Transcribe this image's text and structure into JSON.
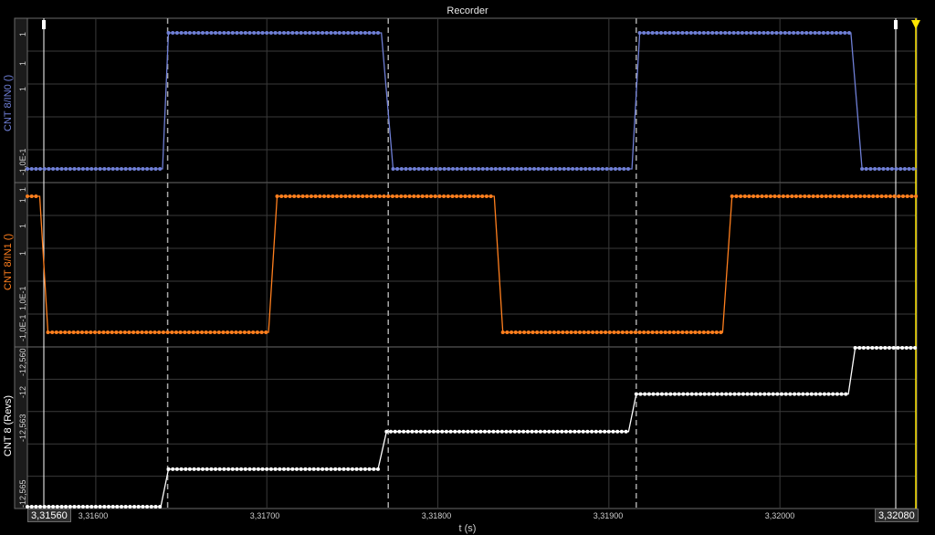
{
  "window": {
    "title": "Recorder"
  },
  "colors": {
    "in0": "#6f7fd6",
    "in1": "#ff7f1e",
    "revs": "#ffffff",
    "cursor": "#ffe600",
    "grid": "#3a3a3a",
    "frame": "#6a6a6a"
  },
  "chart_data": [
    {
      "type": "line",
      "name": "panel-in0",
      "ylabel": "CNT 8/IN0 ()",
      "y_ticks": [
        "1",
        "1",
        "1",
        "-1,0E-1",
        "1"
      ],
      "ylim": [
        -0.1,
        1
      ],
      "x_unit": "s",
      "transitions": [
        {
          "t": 3.3156,
          "y": -0.1
        },
        {
          "t": 3.31639,
          "y": -0.1
        },
        {
          "t": 3.316425,
          "y": 1
        },
        {
          "t": 3.31767,
          "y": 1
        },
        {
          "t": 3.317738,
          "y": -0.1
        },
        {
          "t": 3.319135,
          "y": -0.1
        },
        {
          "t": 3.31918,
          "y": 1
        },
        {
          "t": 3.320415,
          "y": 1
        },
        {
          "t": 3.32048,
          "y": -0.1
        },
        {
          "t": 3.3208,
          "y": -0.1
        }
      ]
    },
    {
      "type": "line",
      "name": "panel-in1",
      "ylabel": "CNT 8/IN1 ()",
      "y_ticks": [
        "1",
        "1",
        "1",
        "1,0E-1",
        "-1,0E-1"
      ],
      "ylim": [
        -0.1,
        1
      ],
      "x_unit": "s",
      "transitions": [
        {
          "t": 3.3156,
          "y": 1
        },
        {
          "t": 3.315672,
          "y": 1
        },
        {
          "t": 3.31572,
          "y": -0.1
        },
        {
          "t": 3.31701,
          "y": -0.1
        },
        {
          "t": 3.31706,
          "y": 1
        },
        {
          "t": 3.31833,
          "y": 1
        },
        {
          "t": 3.31838,
          "y": -0.1
        },
        {
          "t": 3.319665,
          "y": -0.1
        },
        {
          "t": 3.31972,
          "y": 1
        },
        {
          "t": 3.3208,
          "y": 1
        }
      ]
    },
    {
      "type": "line",
      "name": "panel-revs",
      "ylabel": "CNT 8 (Revs)",
      "y_ticks": [
        "-12,560",
        "-12",
        "-12,563",
        "-12,565"
      ],
      "ylim": [
        -12.5655,
        -12.56
      ],
      "x_unit": "s",
      "transitions": [
        {
          "t": 3.3156,
          "y": -12.5655
        },
        {
          "t": 3.31638,
          "y": -12.5655
        },
        {
          "t": 3.316425,
          "y": -12.5642
        },
        {
          "t": 3.31765,
          "y": -12.5642
        },
        {
          "t": 3.3177,
          "y": -12.5629
        },
        {
          "t": 3.319115,
          "y": -12.5629
        },
        {
          "t": 3.31916,
          "y": -12.5616
        },
        {
          "t": 3.3204,
          "y": -12.5616
        },
        {
          "t": 3.32044,
          "y": -12.56
        },
        {
          "t": 3.3208,
          "y": -12.56
        }
      ]
    }
  ],
  "x_axis": {
    "label": "t (s)",
    "tick_labels": [
      "3,31600",
      "3,31700",
      "3,31800",
      "3,31900",
      "3,32000"
    ],
    "tick_values": [
      3.316,
      3.317,
      3.318,
      3.319,
      3.32
    ],
    "start_label": "3,31560",
    "end_label": "3,32080",
    "xlim": [
      3.3156,
      3.3208
    ]
  },
  "cursors": {
    "dashed": [
      3.31642,
      3.31771,
      3.31916
    ]
  }
}
